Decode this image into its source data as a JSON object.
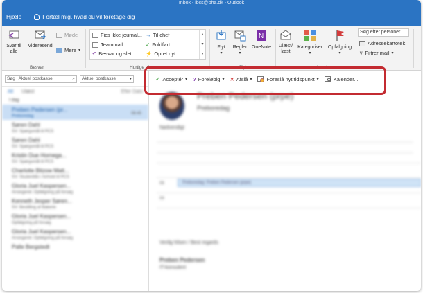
{
  "window": {
    "title": "Inbox - ibcs@pha.dk - Outlook"
  },
  "tabs": {
    "help": "Hjælp",
    "tell_me": "Fortæl mig, hvad du vil foretage dig"
  },
  "ribbon": {
    "respond": {
      "reply_all": "Svar til alle",
      "forward": "Videresend",
      "meeting": "Møde",
      "more": "Mere",
      "group_label": "Besvar"
    },
    "quick_steps": {
      "items": [
        "Fics ikke journal...",
        "Til chef",
        "Teammail",
        "Fuldført",
        "Besvar og slet",
        "Opret nyt"
      ],
      "group_label": "Hurtige trin"
    },
    "move": {
      "move": "Flyt",
      "rules": "Regler",
      "onenote": "OneNote",
      "group_label": "Flyt"
    },
    "tags": {
      "unread_read": "Ulæst/ læst",
      "categorize": "Kategoriser",
      "follow_up": "Opfølgning",
      "group_label": "Mærker"
    },
    "find": {
      "search_people_placeholder": "Søg efter personer",
      "address_book": "Adressekartotek",
      "filter_mail": "Filtrer mail"
    }
  },
  "search": {
    "placeholder": "Søg i Aktuel postkasse",
    "scope": "Aktuel postkasse"
  },
  "mail_list": {
    "filters": [
      "Alt",
      "Ulæst"
    ],
    "sort_label": "Efter Dato",
    "group": "I dag",
    "items": [
      {
        "sender": "Preben Pedersen (pr...",
        "subject": "Preboredag",
        "time": "08:45",
        "selected": true
      },
      {
        "sender": "Søren Dahl",
        "subject": "SV: Spørgsmål til PCS",
        "time": ""
      },
      {
        "sender": "Søren Dahl",
        "subject": "SV: Spørgsmål til PCS",
        "time": ""
      },
      {
        "sender": "Kristin Due Hornega...",
        "subject": "SV: Spørgsmål til PCS",
        "time": ""
      },
      {
        "sender": "Charlotte Bitzow Matt...",
        "subject": "SV: Studentlån i forhold til PCS",
        "time": ""
      },
      {
        "sender": "Gloria Juel Kaspersen...",
        "subject": "Arrangeret: Opfølgning på forsøg",
        "time": ""
      },
      {
        "sender": "Kenneth Jesper Søren...",
        "subject": "SV: Bestilling af Bakerie",
        "time": ""
      },
      {
        "sender": "Gloria Juel Kaspersen...",
        "subject": "Opfølgning på forsøg",
        "time": ""
      },
      {
        "sender": "Gloria Juel Kaspersen...",
        "subject": "Arrangeret: Opfølgning på forsøg",
        "time": ""
      },
      {
        "sender": "Palle Bergstedt",
        "subject": "",
        "time": ""
      }
    ]
  },
  "meeting_actions": {
    "accept": "Acceptér",
    "tentative": "Foreløbig",
    "decline": "Afslå",
    "propose": "Foreslå nyt tidspunkt",
    "calendar": "Kalender..."
  },
  "reading_pane": {
    "sender": "Preben Pedersen (prpe)",
    "subject": "Preboredag",
    "required": "Nødvendigt",
    "timeline_event": "Preboredag: Preben Pedersen (prpe)",
    "greeting": "Venlig hilsen / Best regards",
    "signature_name": "Preben Pedersen",
    "signature_title": "IT-konsulent"
  },
  "colors": {
    "accent": "#2b74c3",
    "highlight": "#c32b31",
    "selected_row": "#c9def5"
  }
}
